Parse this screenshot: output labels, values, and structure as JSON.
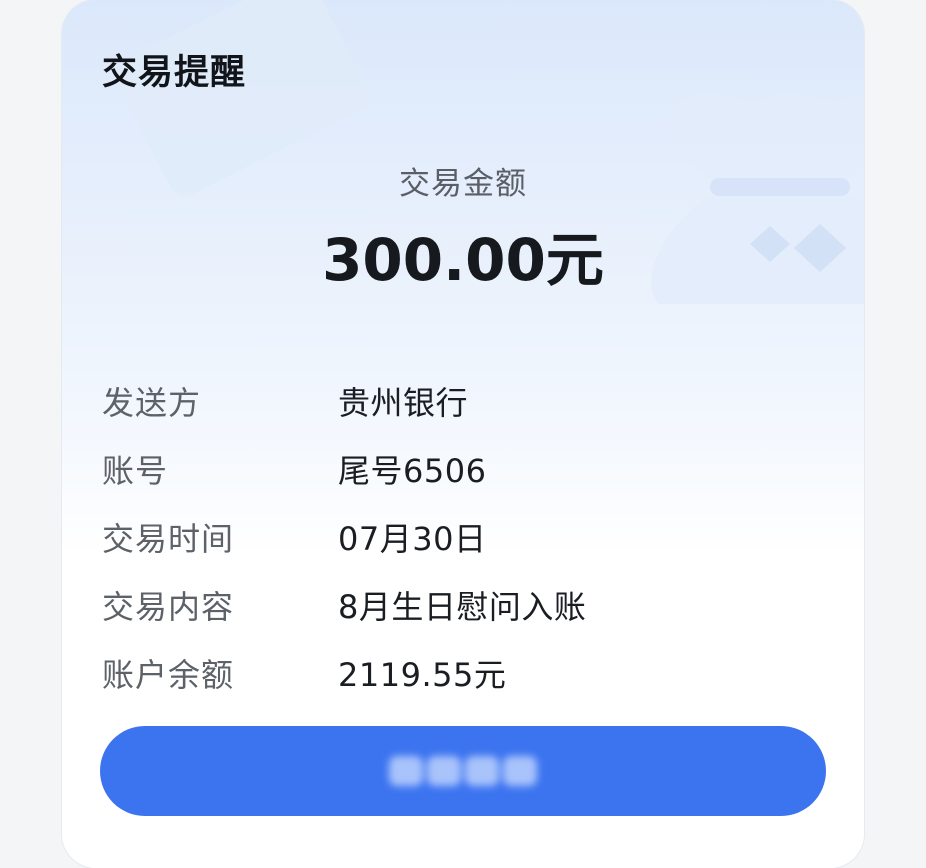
{
  "notice": {
    "title": "交易提醒",
    "amount_label": "交易金额",
    "amount_value": "300.00元",
    "rows": [
      {
        "label": "发送方",
        "value": "贵州银行"
      },
      {
        "label": "账号",
        "value": "尾号6506"
      },
      {
        "label": "交易时间",
        "value": "07月30日"
      },
      {
        "label": "交易内容",
        "value": "8月生日慰问入账"
      },
      {
        "label": "账户余额",
        "value": "2119.55元"
      }
    ],
    "action_button": {
      "label": "",
      "color": "#3c74f0",
      "label_obscured": true
    }
  },
  "icons": {
    "background_decoration_left": "card-shape-icon",
    "background_decoration_right": "money-bag-icon"
  },
  "colors": {
    "accent": "#3c74f0",
    "header_gradient_top": "#dbe8fb",
    "card_background": "#ffffff",
    "page_background": "#f4f5f7",
    "label_text": "#5d6168",
    "value_text": "#1a1d22"
  }
}
